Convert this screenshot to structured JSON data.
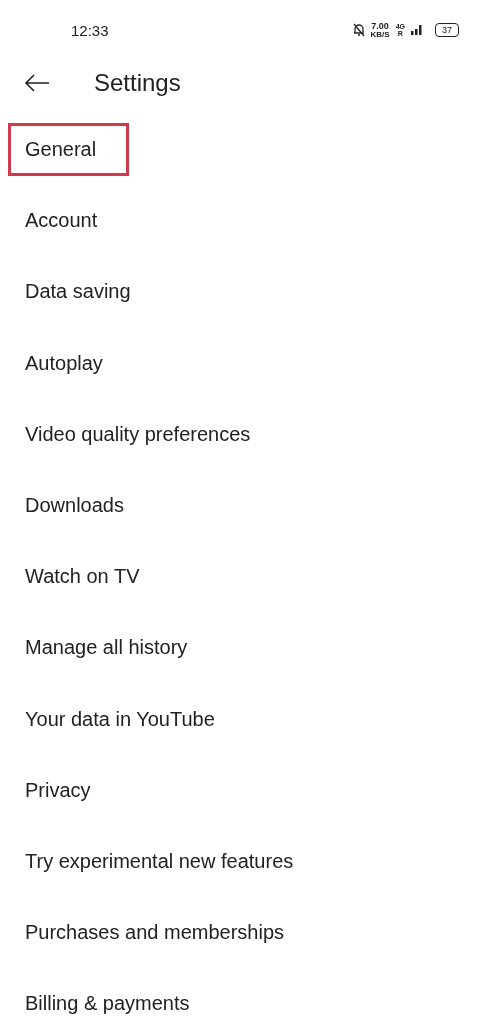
{
  "status_bar": {
    "time": "12:33",
    "speed": "7.00",
    "speed_unit": "KB/S",
    "network": "4G",
    "roaming": "R",
    "battery": "37"
  },
  "header": {
    "title": "Settings"
  },
  "items": [
    {
      "label": "General",
      "highlighted": true
    },
    {
      "label": "Account",
      "highlighted": false
    },
    {
      "label": "Data saving",
      "highlighted": false
    },
    {
      "label": "Autoplay",
      "highlighted": false
    },
    {
      "label": "Video quality preferences",
      "highlighted": false
    },
    {
      "label": "Downloads",
      "highlighted": false
    },
    {
      "label": "Watch on TV",
      "highlighted": false
    },
    {
      "label": "Manage all history",
      "highlighted": false
    },
    {
      "label": "Your data in YouTube",
      "highlighted": false
    },
    {
      "label": "Privacy",
      "highlighted": false
    },
    {
      "label": "Try experimental new features",
      "highlighted": false
    },
    {
      "label": "Purchases and memberships",
      "highlighted": false
    },
    {
      "label": "Billing & payments",
      "highlighted": false
    }
  ]
}
